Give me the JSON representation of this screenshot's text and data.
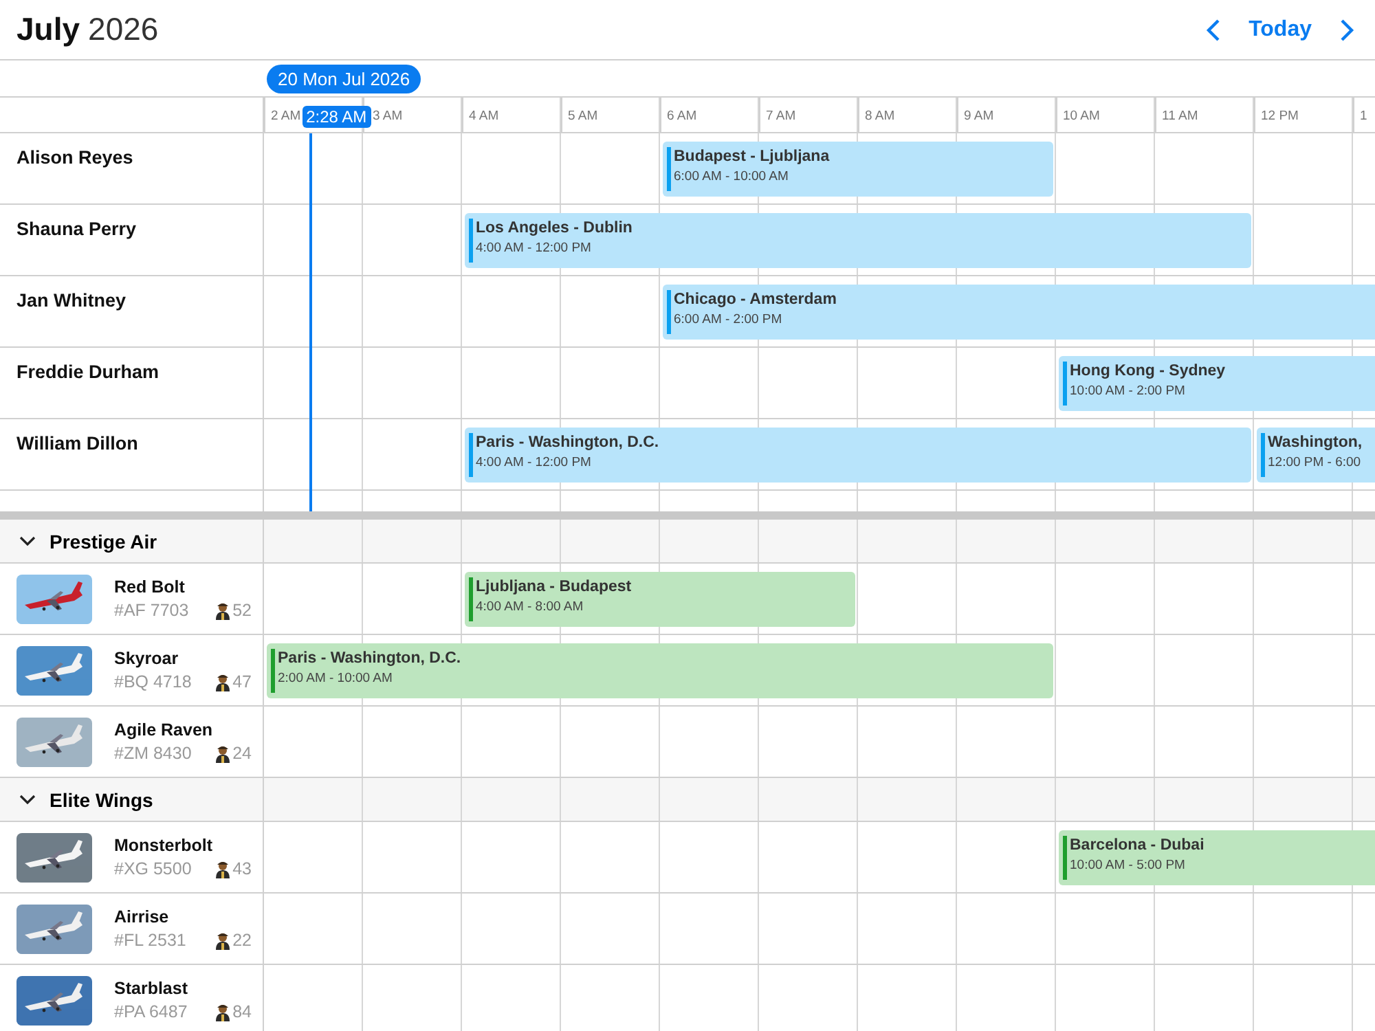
{
  "header": {
    "month": "July",
    "year": "2026",
    "today": "Today"
  },
  "date_badge": "20 Mon Jul 2026",
  "current_time": "2:28 AM",
  "hours": [
    "2 AM",
    "3 AM",
    "4 AM",
    "5 AM",
    "6 AM",
    "7 AM",
    "8 AM",
    "9 AM",
    "10 AM",
    "11 AM",
    "12 PM",
    "1"
  ],
  "people": [
    {
      "name": "Alison Reyes",
      "events": [
        {
          "title": "Budapest - Ljubljana",
          "time": "6:00 AM - 10:00 AM"
        }
      ]
    },
    {
      "name": "Shauna Perry",
      "events": [
        {
          "title": "Los Angeles - Dublin",
          "time": "4:00 AM - 12:00 PM"
        }
      ]
    },
    {
      "name": "Jan Whitney",
      "events": [
        {
          "title": "Chicago - Amsterdam",
          "time": "6:00 AM - 2:00 PM"
        }
      ]
    },
    {
      "name": "Freddie Durham",
      "events": [
        {
          "title": "Hong Kong - Sydney",
          "time": "10:00 AM - 2:00 PM"
        }
      ]
    },
    {
      "name": "William Dillon",
      "events": [
        {
          "title": "Paris - Washington, D.C.",
          "time": "4:00 AM - 12:00 PM"
        },
        {
          "title": "Washington,",
          "time": "12:00 PM - 6:00"
        }
      ]
    }
  ],
  "groups": [
    {
      "name": "Prestige Air",
      "expanded": true,
      "aircraft": [
        {
          "name": "Red Bolt",
          "code": "#AF 7703",
          "crew": "52",
          "events": [
            {
              "title": "Ljubljana - Budapest",
              "time": "4:00 AM - 8:00 AM"
            }
          ]
        },
        {
          "name": "Skyroar",
          "code": "#BQ 4718",
          "crew": "47",
          "events": [
            {
              "title": "Paris - Washington, D.C.",
              "time": "2:00 AM - 10:00 AM"
            }
          ]
        },
        {
          "name": "Agile Raven",
          "code": "#ZM 8430",
          "crew": "24"
        }
      ]
    },
    {
      "name": "Elite Wings",
      "expanded": true,
      "aircraft": [
        {
          "name": "Monsterbolt",
          "code": "#XG 5500",
          "crew": "43",
          "events": [
            {
              "title": "Barcelona - Dubai",
              "time": "10:00 AM - 5:00 PM"
            }
          ]
        },
        {
          "name": "Airrise",
          "code": "#FL 2531",
          "crew": "22"
        },
        {
          "name": "Starblast",
          "code": "#PA 6487",
          "crew": "84"
        }
      ]
    }
  ]
}
